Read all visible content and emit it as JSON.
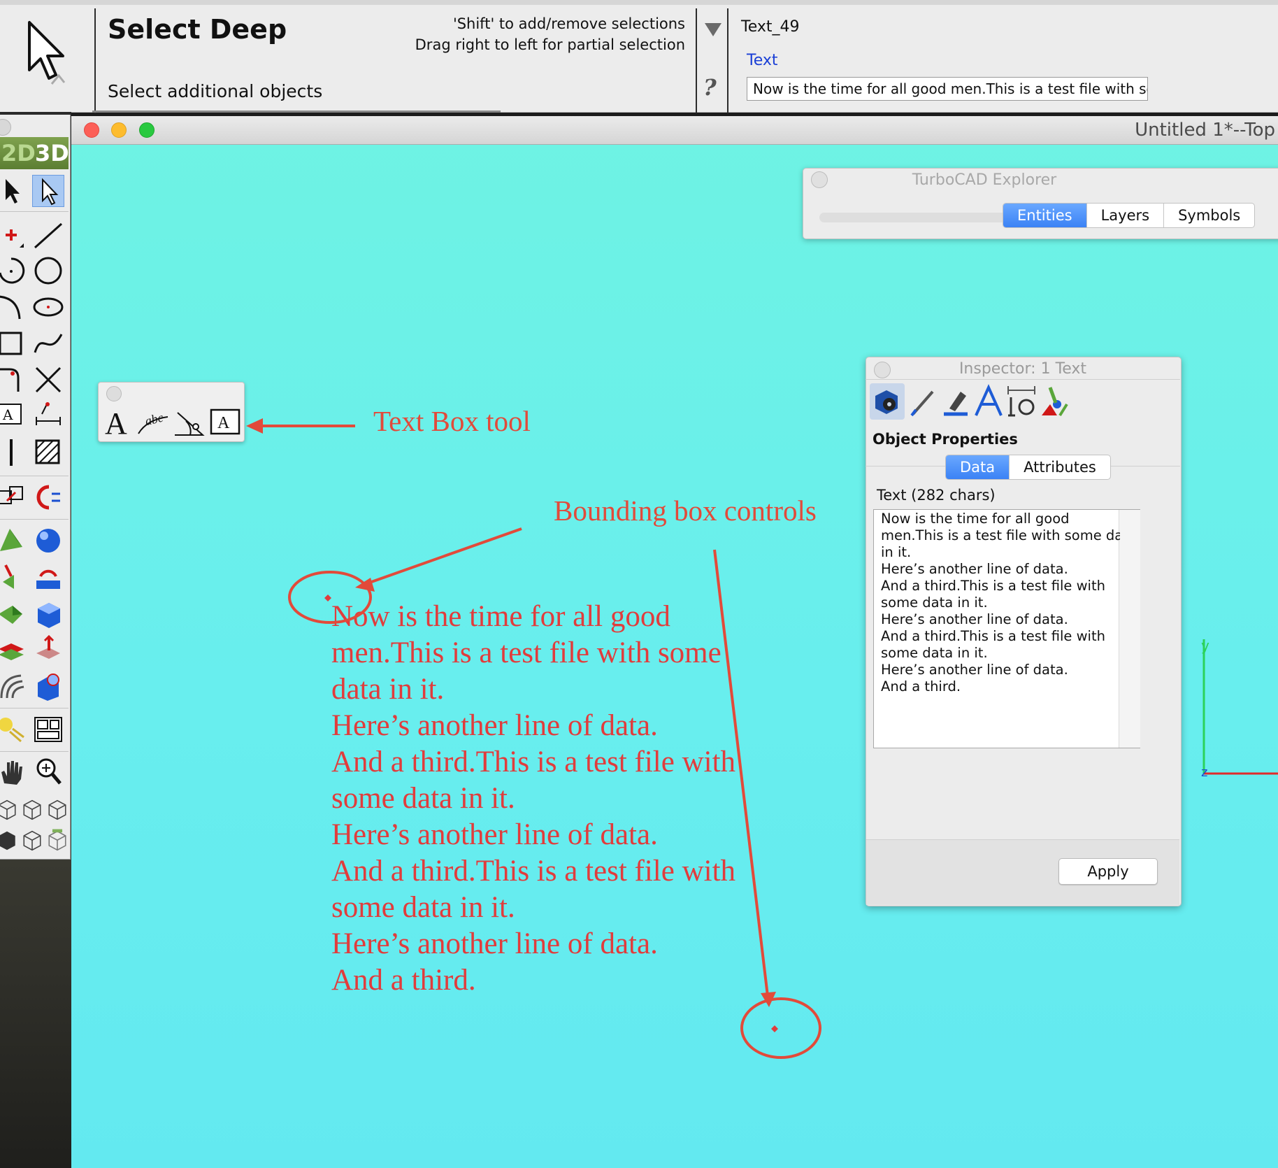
{
  "context_bar": {
    "tool_title": "Select Deep",
    "tool_subtitle": "Select additional objects",
    "hint_line1": "'Shift' to add/remove selections",
    "hint_line2": "Drag right to left for partial selection",
    "help_glyph": "?",
    "entity_name": "Text_49",
    "entity_type": "Text",
    "text_field_value": "Now is the time for all good men.This is a test file with so",
    "icons": [
      "select-arrow-icon",
      "dropdown-triangle-icon",
      "help-icon"
    ]
  },
  "window": {
    "title": "Untitled 1*--Top"
  },
  "palette": {
    "mode_2d": "2D",
    "mode_3d": "3D",
    "tools": [
      "select-icon",
      "select-deep-icon",
      "point-icon",
      "line-icon",
      "arc-icon",
      "circle-icon",
      "curve-arc-icon",
      "ellipse-icon",
      "rectangle-icon",
      "spline-icon",
      "fillet-icon",
      "intersect-icon",
      "text-box-icon",
      "dimension-icon",
      "vertical-line-icon",
      "hatch-icon",
      "copy-icon",
      "mirror-icon",
      "pyramid-icon",
      "sphere-icon",
      "extrude-icon",
      "revolve-icon",
      "wedge-icon",
      "box-icon",
      "layer-icon",
      "push-pull-icon",
      "loft-icon",
      "boolean-icon",
      "light-icon",
      "viewport-icon",
      "pan-hand-icon",
      "zoom-icon",
      "view-front-icon",
      "view-iso-icon",
      "view-right-icon",
      "render-solid-icon",
      "render-wire-icon",
      "render-hidden-icon"
    ]
  },
  "text_palette": {
    "tools": [
      "text-icon",
      "text-on-arc-icon",
      "text-on-path-icon",
      "text-box-tool-icon"
    ],
    "glyphs": [
      "A",
      "abc",
      "A"
    ]
  },
  "explorer": {
    "title": "TurboCAD Explorer",
    "tabs": [
      "Entities",
      "Layers",
      "Symbols"
    ],
    "active_tab": "Entities"
  },
  "inspector": {
    "title": "Inspector:  1 Text",
    "section": "Object Properties",
    "tabs": [
      "Data",
      "Attributes"
    ],
    "active_tab": "Data",
    "field_label": "Text (282 chars)",
    "lines": [
      "Now is the time for all good",
      "men.This is a test file with some da",
      "in it.",
      "Here’s another line of data.",
      "And a third.This is a test file with",
      "some data in it.",
      "Here’s another line of data.",
      "And a third.This is a test file with",
      "some data in it.",
      "Here’s another line of data.",
      "And a third."
    ],
    "apply_label": "Apply",
    "tab_icons": [
      "object-properties-icon",
      "pen-icon",
      "brush-icon",
      "font-icon",
      "dimension-style-icon",
      "effects-icon"
    ]
  },
  "drawing": {
    "text_lines": [
      "Now is the time for all good",
      "men.This is a test file with some",
      "data in it.",
      "Here’s another line of data.",
      "And a third.This is a test file with",
      "some data in it.",
      "Here’s another line of data.",
      "And a third.This is a test file with",
      "some data in it.",
      "Here’s another line of data.",
      "And a third."
    ],
    "axis_labels": {
      "y": "y",
      "z": "z"
    }
  },
  "annotations": {
    "text_box_label": "Text Box tool",
    "bounding_box_label": "Bounding box controls"
  },
  "colors": {
    "canvas": "#68eeee",
    "annotation_red": "#e24a3a",
    "drawn_text": "#e13c3c",
    "selected_blue": "#3b82f5",
    "link_blue": "#1a3fd6"
  }
}
